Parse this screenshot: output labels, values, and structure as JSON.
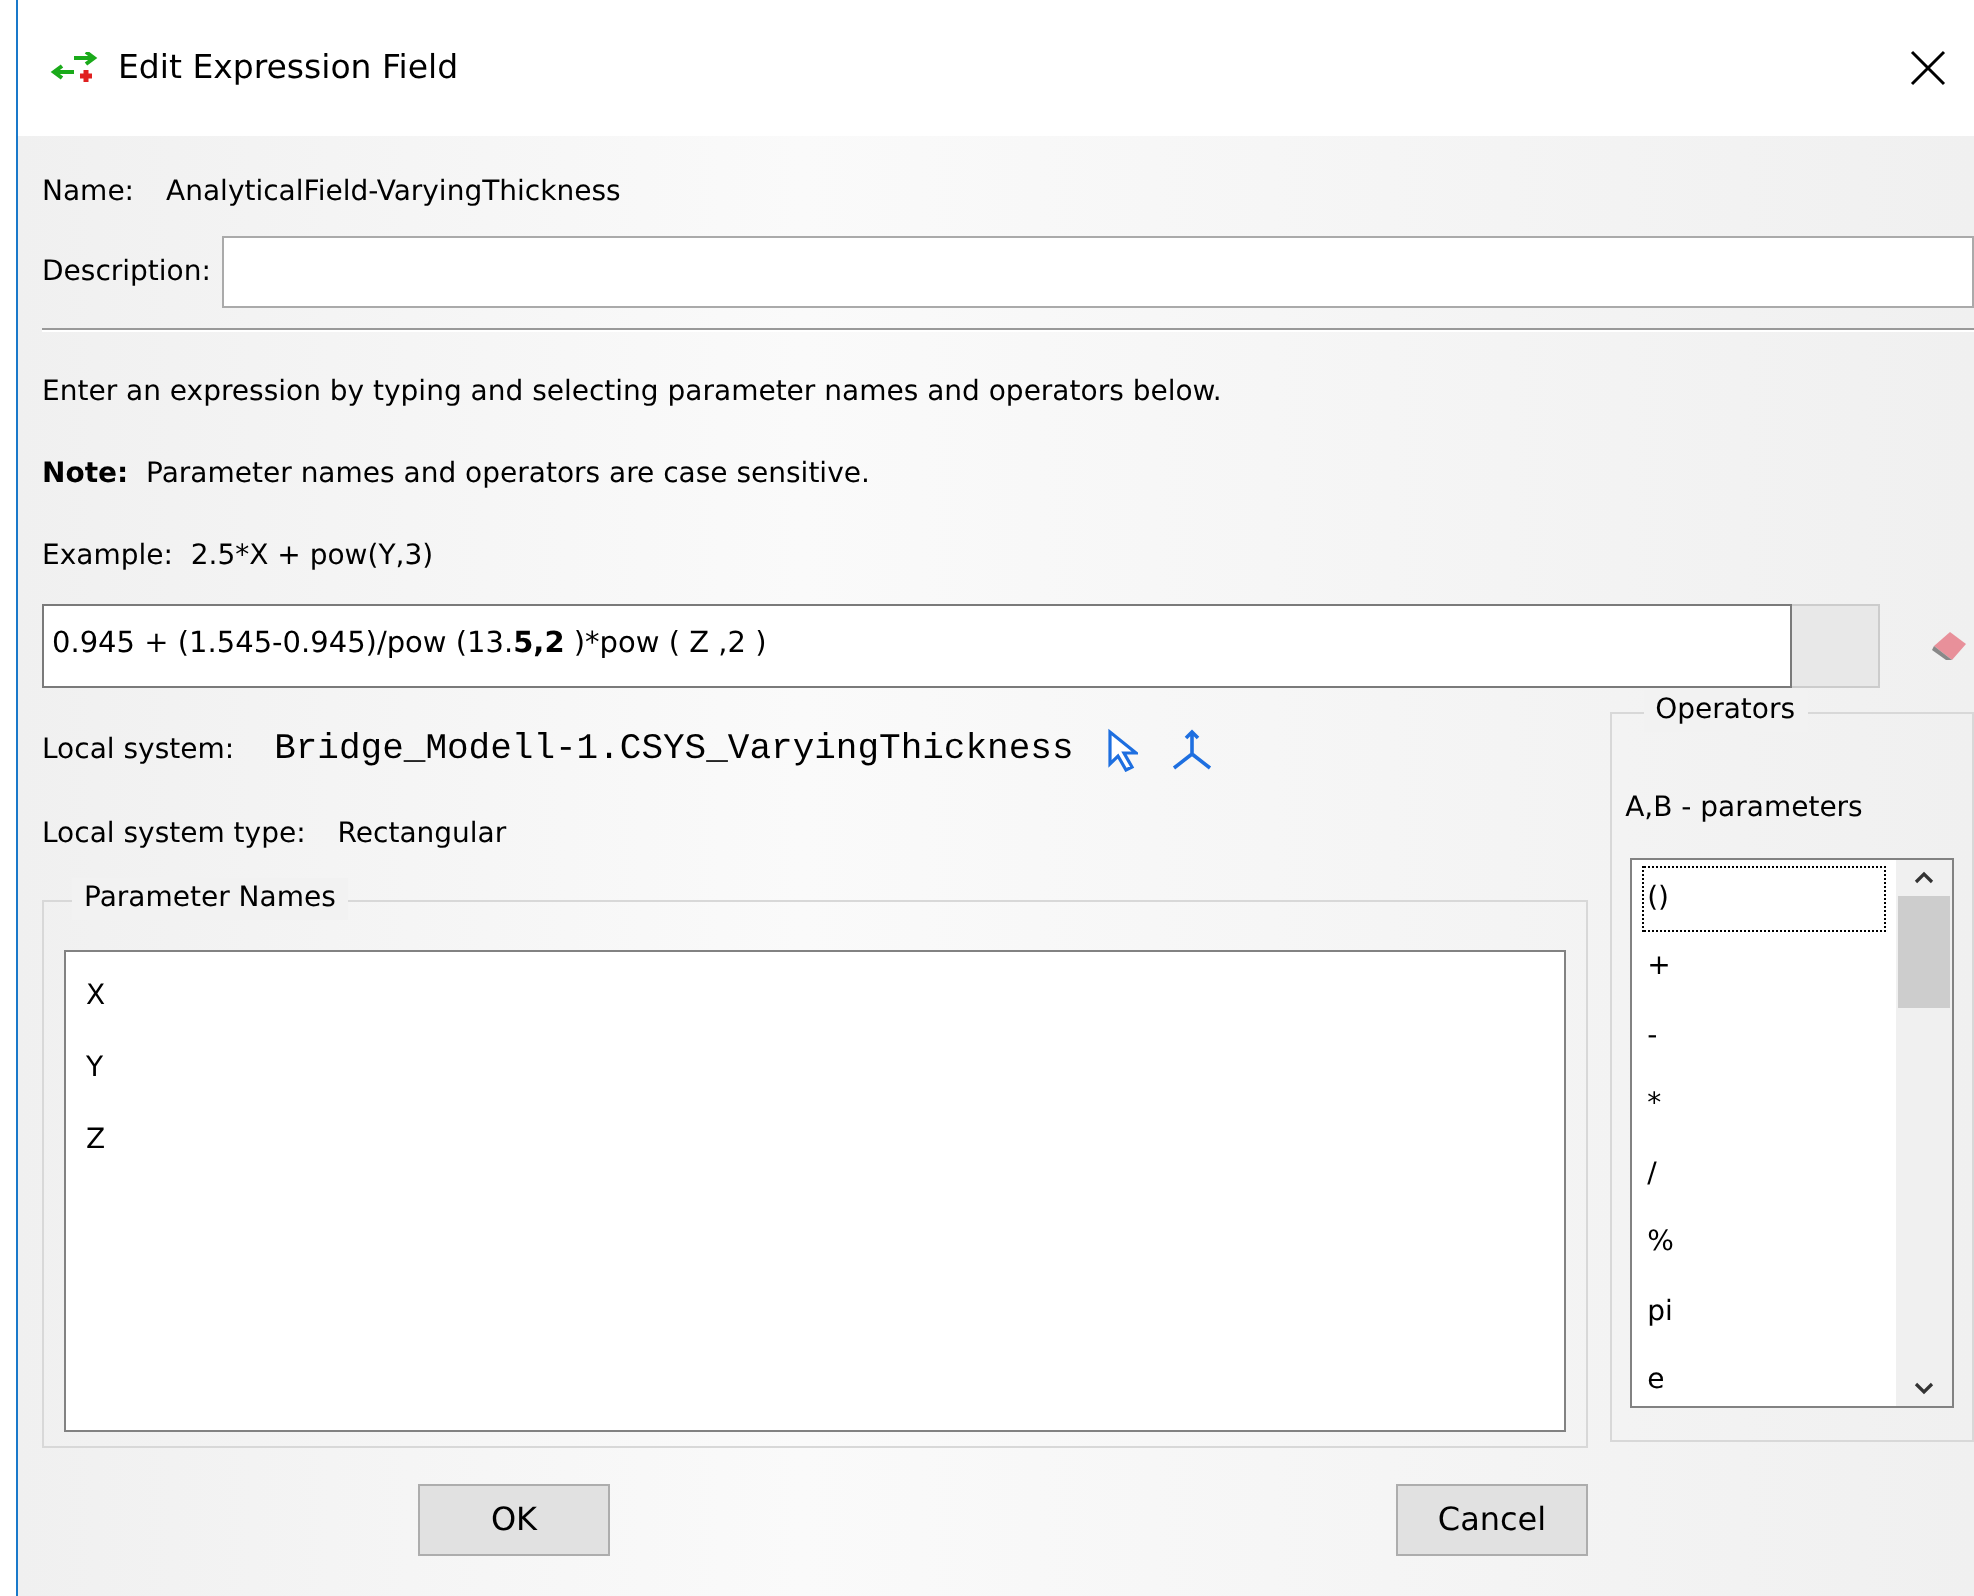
{
  "window": {
    "title": "Edit Expression Field"
  },
  "name": {
    "label": "Name:",
    "value": "AnalyticalField-VaryingThickness"
  },
  "description": {
    "label": "Description:"
  },
  "instructions": [
    "Enter an expression by typing and selecting parameter names and operators below.",
    "**Note:**  Parameter names and operators are case sensitive.",
    "Example:  2.5*X + pow(Y,3)"
  ],
  "expression": {
    "value": "0.945 + (1.545-0.945)/pow (13.**5,2** )*pow ( Z ,2 )"
  },
  "local_system": {
    "label": "Local system:",
    "value": "Bridge_Modell-1.CSYS_VaryingThickness"
  },
  "local_system_type": {
    "label": "Local system type:",
    "value": "Rectangular"
  },
  "parameter_names": {
    "title": "Parameter Names",
    "items": [
      {
        "label": "X",
        "selected": false
      },
      {
        "label": "Y",
        "selected": false
      },
      {
        "label": "Z",
        "selected": false
      }
    ]
  },
  "operators": {
    "title": "Operators",
    "hint": "A,B - parameters",
    "items": [
      {
        "label": "()",
        "selected": true
      },
      {
        "label": "+",
        "selected": false
      },
      {
        "label": "-",
        "selected": false
      },
      {
        "label": "*",
        "selected": false
      },
      {
        "label": "/",
        "selected": false
      },
      {
        "label": "%",
        "selected": false
      },
      {
        "label": "pi",
        "selected": false
      },
      {
        "label": "e",
        "selected": false
      }
    ]
  },
  "buttons": [
    "OK",
    "Cancel"
  ]
}
